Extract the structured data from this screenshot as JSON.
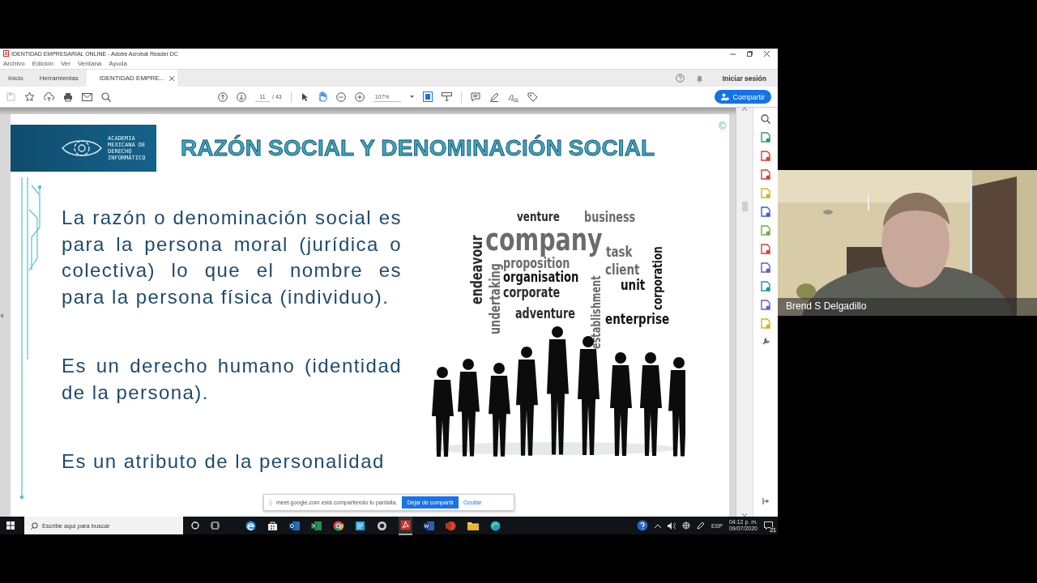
{
  "window": {
    "title": "IDENTIDAD EMPRESARIAL ONLINE - Adobe Acrobat Reader DC"
  },
  "menu": [
    "Archivo",
    "Edición",
    "Ver",
    "Ventana",
    "Ayuda"
  ],
  "tabs": [
    {
      "label": "Inicio",
      "selected": false,
      "closable": false
    },
    {
      "label": "Herramientas",
      "selected": false,
      "closable": false
    },
    {
      "label": "IDENTIDAD EMPRE...",
      "selected": true,
      "closable": true
    }
  ],
  "account": {
    "sign_in": "Iniciar sesión"
  },
  "toolbar": {
    "page": "11",
    "page_total": "/ 43",
    "zoom": "107%",
    "share": "Compartir"
  },
  "slide": {
    "org_lines": [
      "ACADEMIA",
      "MEXICANA DE",
      "DERECHO",
      "INFORMÁTICO"
    ],
    "title": "RAZÓN SOCIAL Y DENOMINACIÓN SOCIAL",
    "copyright": "©",
    "paragraphs": [
      "La razón o denominación social es para la persona moral (jurídica o colectiva) lo que el nombre es para la persona física (individuo).",
      "Es un derecho humano (identidad de la persona).",
      "Es un atributo de la personalidad"
    ],
    "word_cloud": [
      {
        "text": "venture",
        "color": "#2b2b2b",
        "vertical": false
      },
      {
        "text": "business",
        "color": "#6b6b6b",
        "vertical": false
      },
      {
        "text": "company",
        "color": "#6b6b6b",
        "vertical": false
      },
      {
        "text": "endeavour",
        "color": "#2b2b2b",
        "vertical": true
      },
      {
        "text": "undertaking",
        "color": "#6b6b6b",
        "vertical": true
      },
      {
        "text": "proposition",
        "color": "#6b6b6b",
        "vertical": false
      },
      {
        "text": "organisation",
        "color": "#111111",
        "vertical": false
      },
      {
        "text": "corporate",
        "color": "#2b2b2b",
        "vertical": false
      },
      {
        "text": "establishment",
        "color": "#6b6b6b",
        "vertical": true
      },
      {
        "text": "task",
        "color": "#6b6b6b",
        "vertical": false
      },
      {
        "text": "client",
        "color": "#6b6b6b",
        "vertical": false
      },
      {
        "text": "unit",
        "color": "#111111",
        "vertical": false
      },
      {
        "text": "corporation",
        "color": "#111111",
        "vertical": true
      },
      {
        "text": "adventure",
        "color": "#2b2b2b",
        "vertical": false
      },
      {
        "text": "enterprise",
        "color": "#111111",
        "vertical": false
      }
    ]
  },
  "share_banner": {
    "message": "meet.google.com está compartiendo tu pantalla.",
    "stop": "Dejar de compartir",
    "hide": "Ocultar"
  },
  "taskbar": {
    "search_placeholder": "Escribe aquí para buscar",
    "language": "ESP",
    "time": "04:12 p. m.",
    "date": "09/07/2020",
    "notifications": "21"
  },
  "video": {
    "name": "Brend S Delgadillo"
  }
}
